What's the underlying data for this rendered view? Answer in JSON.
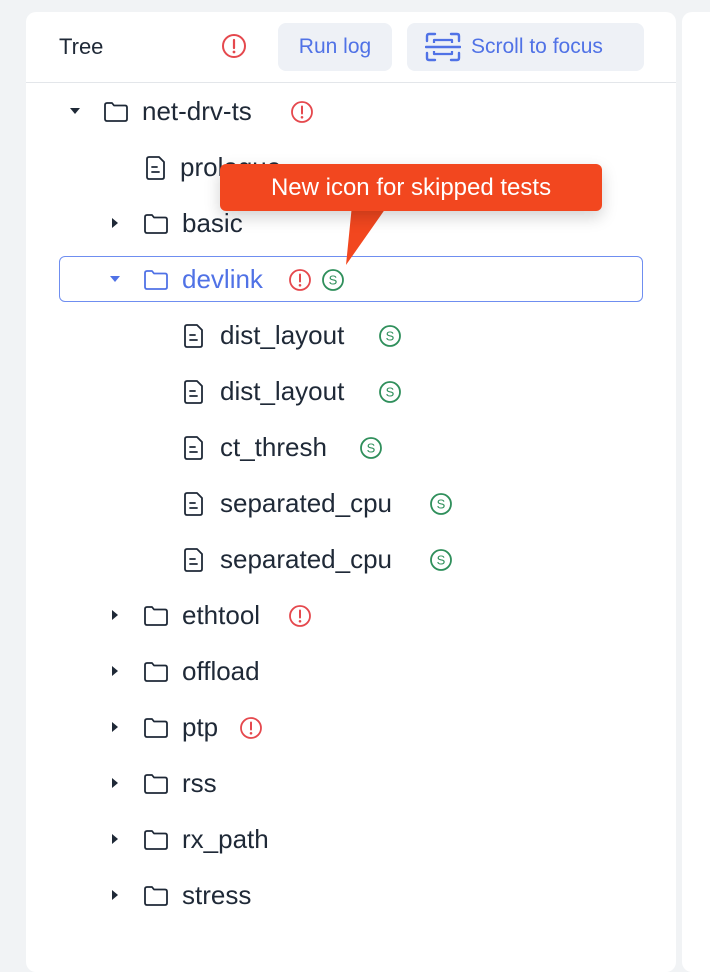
{
  "header": {
    "title": "Tree",
    "run_log_label": "Run log",
    "scroll_to_focus_label": "Scroll to focus"
  },
  "callout": {
    "text": "New icon for skipped tests"
  },
  "colors": {
    "accent": "#5072e6",
    "error": "#e5484d",
    "skipped": "#2f8f5b",
    "callout": "#f2471f",
    "text": "#1f2937"
  },
  "tree": {
    "net_drv_ts": "net-drv-ts",
    "prologue": "prologue",
    "basic": "basic",
    "devlink": "devlink",
    "dist_layout_1": "dist_layout",
    "dist_layout_2": "dist_layout",
    "ct_thresh": "ct_thresh",
    "separated_cpu_1": "separated_cpu",
    "separated_cpu_2": "separated_cpu",
    "ethtool": "ethtool",
    "offload": "offload",
    "ptp": "ptp",
    "rss": "rss",
    "rx_path": "rx_path",
    "stress": "stress"
  },
  "icons": {
    "folder": "folder-icon",
    "file": "file-icon",
    "error_badge": "alert-circle-icon",
    "skipped_badge": "skipped-s-icon",
    "caret_expanded": "caret-down-icon",
    "caret_collapsed": "caret-right-icon",
    "scroll": "scan-focus-icon"
  }
}
